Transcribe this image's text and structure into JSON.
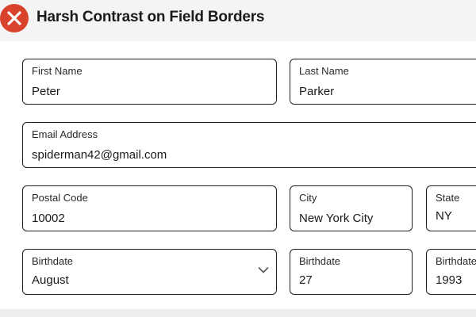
{
  "header": {
    "title": "Harsh Contrast on Field Borders",
    "close_icon": "close-x-icon",
    "close_color": "#d9432b"
  },
  "form": {
    "first_name": {
      "label": "First Name",
      "value": "Peter"
    },
    "last_name": {
      "label": "Last Name",
      "value": "Parker"
    },
    "email": {
      "label": "Email Address",
      "value": "spiderman42@gmail.com"
    },
    "postal_code": {
      "label": "Postal Code",
      "value": "10002"
    },
    "city": {
      "label": "City",
      "value": "New York City"
    },
    "state": {
      "label": "State",
      "value": "NY"
    },
    "birth_month": {
      "label": "Birthdate",
      "value": "August",
      "icon": "chevron-down-icon"
    },
    "birth_day": {
      "label": "Birthdate",
      "value": "27"
    },
    "birth_year": {
      "label": "Birthdate",
      "value": "1993"
    }
  },
  "colors": {
    "border": "#1f1f1f",
    "background": "#f4f4f4",
    "card": "#ffffff"
  }
}
